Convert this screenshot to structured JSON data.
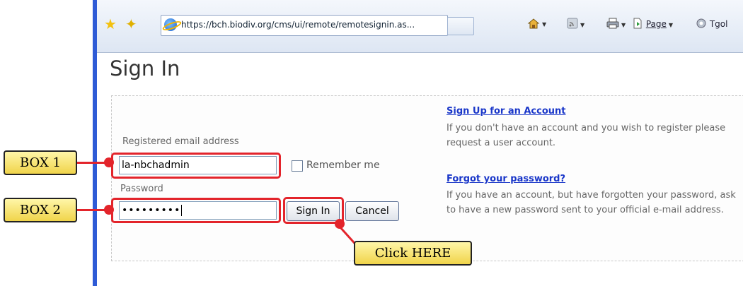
{
  "browser": {
    "url": "https://bch.biodiv.org/cms/ui/remote/remotesignin.as...",
    "tools": {
      "page_label": "Page",
      "tools_label": "Tgol"
    }
  },
  "page": {
    "title": "Sign In"
  },
  "form": {
    "email_label": "Registered email address",
    "email_value": "la-nbchadmin",
    "remember_label": "Remember me",
    "password_label": "Password",
    "password_value": "•••••••••",
    "signin_label": "Sign In",
    "cancel_label": "Cancel"
  },
  "info": {
    "signup_link": "Sign Up for an Account",
    "signup_text": "If you don't have an account and you wish to register please request a user account.",
    "forgot_link": "Forgot your password?",
    "forgot_text": "If you have an account, but have forgotten your password, ask to have a new password sent to your official e-mail address."
  },
  "annotations": {
    "box1": "BOX 1",
    "box2": "BOX 2",
    "click_here": "Click HERE"
  },
  "colors": {
    "accent": "#2e5bd6",
    "highlight": "#e3242b",
    "callout_fill": "#f0d44a",
    "link": "#1a37c9"
  }
}
